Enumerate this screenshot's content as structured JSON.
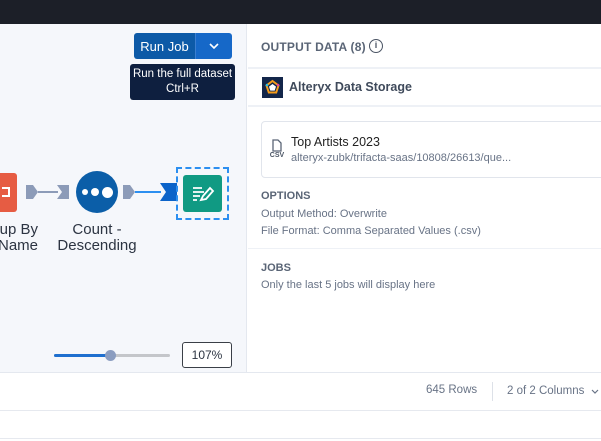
{
  "canvas": {
    "run_job_label": "Run Job",
    "tooltip": {
      "line1": "Run the full dataset",
      "line2": "Ctrl+R"
    },
    "nodes": [
      {
        "label_line1": "up By",
        "label_line2": "Name",
        "color": "#e65c43"
      },
      {
        "label_line1": "Count -",
        "label_line2": "Descending",
        "color": "#0b5ea8"
      },
      {
        "label_line1": "",
        "label_line2": "",
        "color": "#109a83"
      }
    ],
    "zoom_level_percent": 107,
    "zoom_label": "107%",
    "zoom_slider_fraction": 0.48
  },
  "panel": {
    "title": "OUTPUT DATA (8)",
    "storage_label": "Alteryx Data Storage",
    "output": {
      "name": "Top Artists 2023",
      "path": "alteryx-zubk/trifacta-saas/10808/26613/que...",
      "file_icon_label": "CSV"
    },
    "options_heading": "OPTIONS",
    "output_method": "Output Method: Overwrite",
    "file_format": "File Format: Comma Separated Values (.csv)",
    "jobs_heading": "JOBS",
    "jobs_note": "Only the last 5 jobs will display here"
  },
  "footer": {
    "rows": "645 Rows",
    "columns": "2 of 2 Columns"
  }
}
